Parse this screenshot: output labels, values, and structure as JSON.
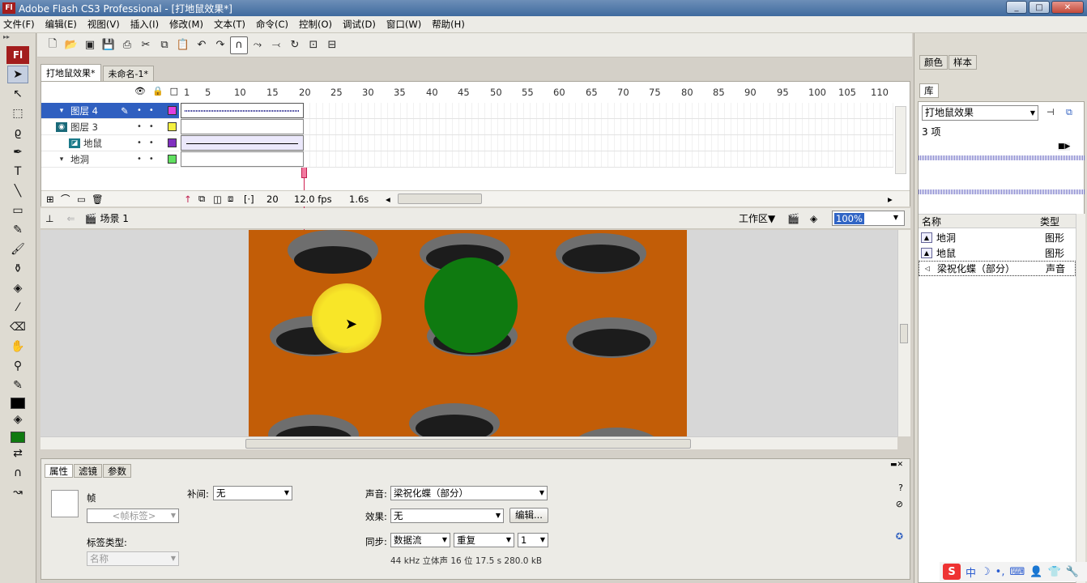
{
  "window": {
    "title": "Adobe Flash CS3 Professional - [打地鼠效果*]",
    "app_icon": "Fl",
    "min": "_",
    "max": "□",
    "close": "✕"
  },
  "menu": [
    "文件(F)",
    "编辑(E)",
    "视图(V)",
    "插入(I)",
    "修改(M)",
    "文本(T)",
    "命令(C)",
    "控制(O)",
    "调试(D)",
    "窗口(W)",
    "帮助(H)"
  ],
  "tools_logo": "Fl",
  "doc_tabs": [
    "打地鼠效果*",
    "未命名-1*"
  ],
  "timeline": {
    "ruler": [
      "1",
      "5",
      "10",
      "15",
      "20",
      "25",
      "30",
      "35",
      "40",
      "45",
      "50",
      "55",
      "60",
      "65",
      "70",
      "75",
      "80",
      "85",
      "90",
      "95",
      "100",
      "105",
      "110"
    ],
    "layers": [
      {
        "name": "图层 4",
        "color": "#e040e0",
        "selected": true
      },
      {
        "name": "图层 3",
        "color": "#f4f040",
        "selected": false
      },
      {
        "name": "地鼠",
        "color": "#8030c0",
        "selected": false
      },
      {
        "name": "地洞",
        "color": "#60e060",
        "selected": false
      }
    ],
    "current_frame": "20",
    "fps": "12.0 fps",
    "time": "1.6s"
  },
  "editbar": {
    "scene": "场景 1",
    "workspace": "工作区▼",
    "zoom": "100%"
  },
  "properties": {
    "tabs": [
      "属性",
      "滤镜",
      "参数"
    ],
    "frame_label": "帧",
    "frame_label_placeholder": "<帧标签>",
    "label_type_caption": "标签类型:",
    "label_type_value": "名称",
    "tween_caption": "补间:",
    "tween_value": "无",
    "sound_caption": "声音:",
    "sound_value": "梁祝化蝶（部分）",
    "effect_caption": "效果:",
    "effect_value": "无",
    "edit_button": "编辑...",
    "sync_caption": "同步:",
    "sync_value": "数据流",
    "repeat_value": "重复",
    "repeat_count": "1",
    "sound_info": "44 kHz 立体声 16 位 17.5 s 280.0 kB"
  },
  "right": {
    "top_tabs": [
      "颜色",
      "样本"
    ],
    "lib_tab": "库",
    "lib_doc": "打地鼠效果",
    "item_count": "3 项",
    "col_name": "名称",
    "col_type": "类型",
    "items": [
      {
        "name": "地洞",
        "type": "图形"
      },
      {
        "name": "地鼠",
        "type": "图形"
      },
      {
        "name": "梁祝化蝶（部分）",
        "type": "声音"
      }
    ]
  },
  "ime": {
    "logo": "S",
    "lang": "中"
  },
  "colors": {
    "stage": "#c25d07",
    "green_ball": "#0f7a10",
    "yellow_ball": "#f5e132",
    "hole_rim": "#6e6e6e"
  }
}
